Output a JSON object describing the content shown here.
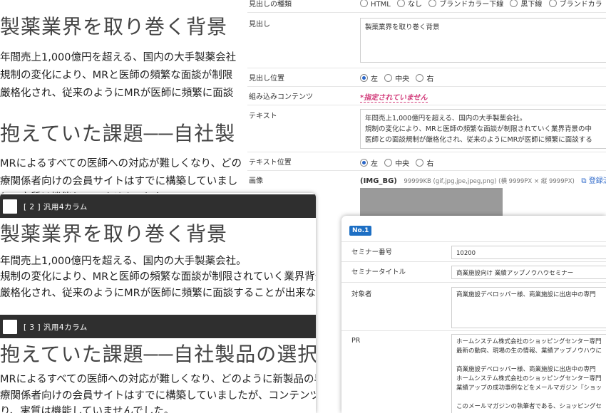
{
  "article": {
    "heading1": "製薬業界を取り巻く背景",
    "para1": [
      "年間売上1,000億円を超える、国内の大手製薬会社",
      "規制の変化により、MRと医師の頻繁な面談が制限",
      "厳格化され、従来のようにMRが医師に頻繁に面談"
    ],
    "heading2": "抱えていた課題──自社製",
    "para2": [
      "MRによるすべての医師への対応が難しくなり、どの",
      "療関係者向けの会員サイトはすでに構築していまし",
      "り、実質は機能していませんでした。"
    ]
  },
  "form": {
    "row_heading_type": {
      "label": "見出しの種類",
      "options": [
        "HTML",
        "なし",
        "ブランドカラー下線",
        "黒下線",
        "ブランドカラ"
      ]
    },
    "row_heading": {
      "label": "見出し",
      "value": "製薬業界を取り巻く背景"
    },
    "row_heading_pos": {
      "label": "見出し位置",
      "options": [
        "左",
        "中央",
        "右"
      ]
    },
    "row_embed": {
      "label": "組み込みコンテンツ",
      "value": "*指定されていません"
    },
    "row_text": {
      "label": "テキスト",
      "lines": [
        "年間売上1,000億円を超える、国内の大手製薬会社。",
        "規制の変化により、MRと医師の頻繁な面談が制限されていく業界背景の中",
        "医師との面談規制が厳格化され、従来のようにMRが医師に頻繁に面談する"
      ]
    },
    "row_text_pos": {
      "label": "テキスト位置",
      "options": [
        "左",
        "中央",
        "右"
      ]
    },
    "row_image": {
      "label": "画像",
      "tag": "(IMG_BG)",
      "meta": "99999KB (gif,jpg,jpe,jpeg,png) (横 9999PX × 縦 9999PX)",
      "link": "登録済み"
    }
  },
  "modules": {
    "mod2": {
      "title": "[ 2 ] 汎用4カラム",
      "heading": "製薬業界を取り巻く背景",
      "lines": [
        "年間売上1,000億円を超える、国内の大手製薬会社。",
        "規制の変化により、MRと医師の頻繁な面談が制限されていく業界背景の",
        "厳格化され、従来のようにMRが医師に頻繁に面談することが出来なくな"
      ]
    },
    "mod3": {
      "title": "[ 3 ] 汎用4カラム",
      "heading": "抱えていた課題──自社製品の選択",
      "lines": [
        "MRによるすべての医師への対応が難しくなり、どのように新製品の早期浸",
        "療関係者向けの会員サイトはすでに構築していましたが、コンテンツの追",
        "り、実質は機能していませんでした。"
      ]
    }
  },
  "seminar": {
    "badge": "No.1",
    "number": {
      "label": "セミナー番号",
      "value": "10200"
    },
    "title": {
      "label": "セミナータイトル",
      "value": "商業施設向け 業績アップノウハウセミナー"
    },
    "target": {
      "label": "対象者",
      "value": "商業施設デベロッパー様、商業施設に出店中の専門"
    },
    "pr": {
      "label": "PR",
      "lines": [
        "ホームシステム株式会社のショッピングセンター専門",
        "最新の動向、現場の生の情報、業績アップノウハウに",
        "",
        "商業施設デベロッパー様、商業施設に出店中の専門",
        "ホームシステム株式会社のショッピングセンター専門",
        "業績アップの成功事例などをメールマガジン『ショッ",
        "",
        "このメールマガジンの執筆者である、ショッピングセ"
      ]
    }
  }
}
